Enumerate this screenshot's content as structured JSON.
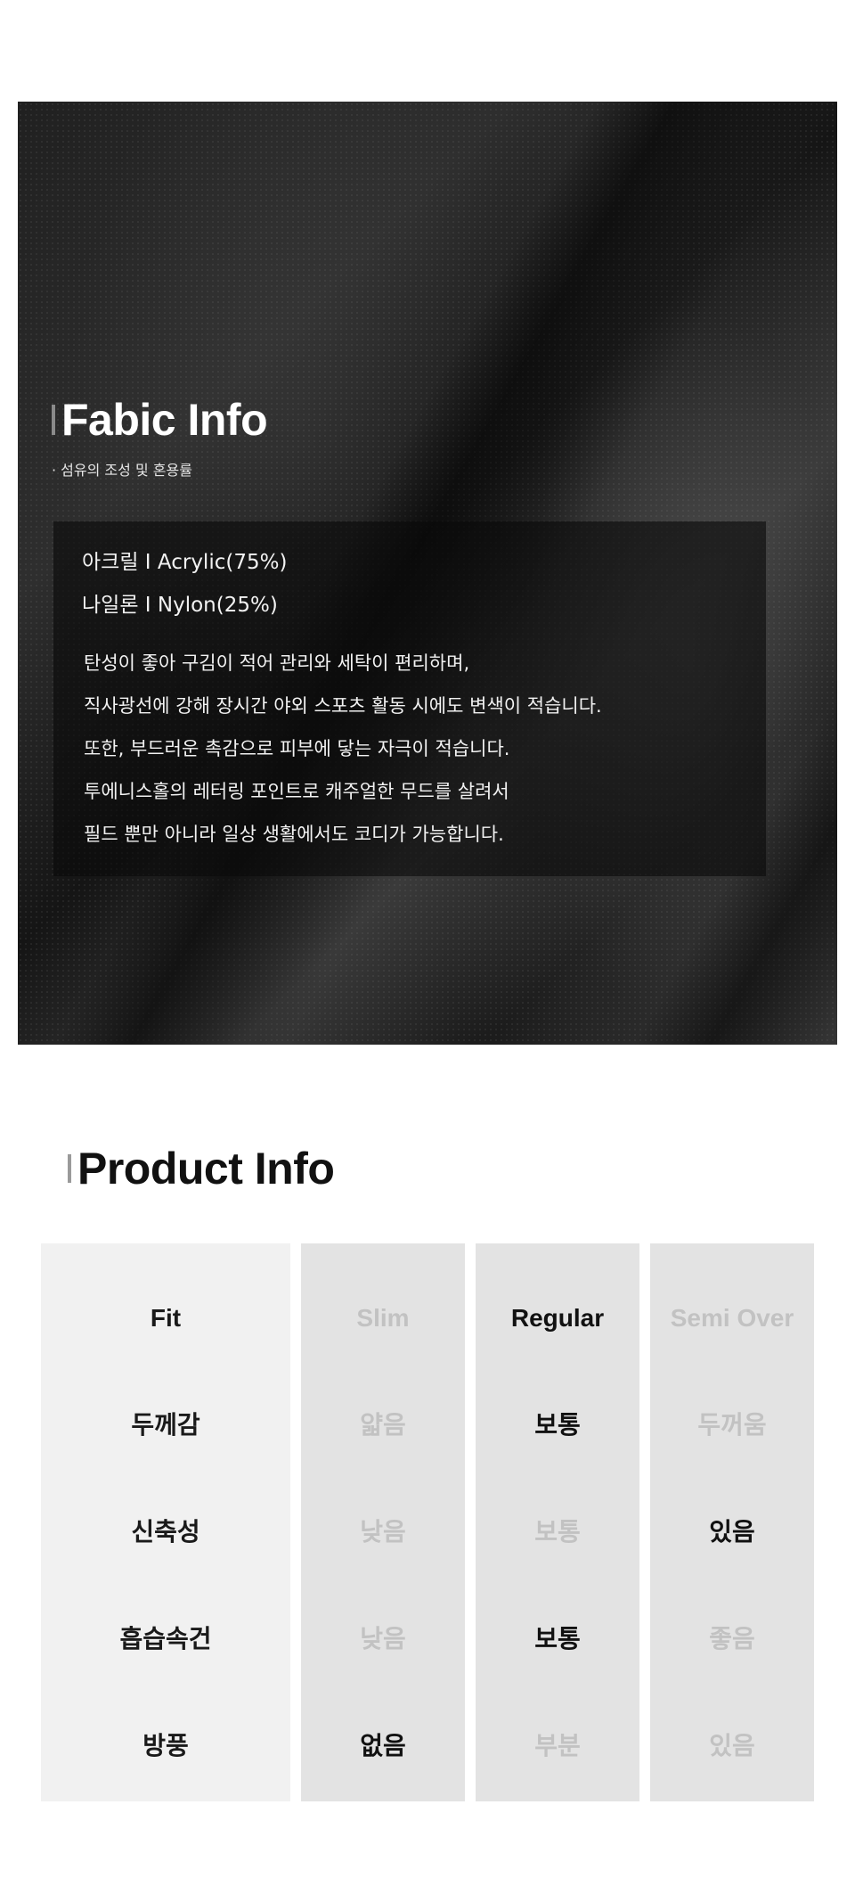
{
  "fabric_info": {
    "title": "Fabic Info",
    "subtitle": "· 섬유의 조성 및 혼용률",
    "composition": [
      "아크릴 I Acrylic(75%)",
      "나일론 I Nylon(25%)"
    ],
    "description": [
      "탄성이 좋아 구김이 적어 관리와 세탁이 편리하며,",
      "직사광선에 강해 장시간 야외 스포츠 활동 시에도 변색이 적습니다.",
      "또한, 부드러운 촉감으로 피부에 닿는 자극이 적습니다.",
      "투에니스홀의 레터링 포인트로 캐주얼한 무드를 살려서",
      "필드 뿐만 아니라 일상 생활에서도 코디가 가능합니다."
    ]
  },
  "product_info": {
    "title": "Product Info",
    "rows": [
      {
        "label": "Fit",
        "options": [
          "Slim",
          "Regular",
          "Semi Over"
        ],
        "selected": [
          "Regular"
        ]
      },
      {
        "label": "두께감",
        "options": [
          "얇음",
          "보통",
          "두꺼움"
        ],
        "selected": [
          "보통"
        ]
      },
      {
        "label": "신축성",
        "options": [
          "낮음",
          "보통",
          "있음"
        ],
        "selected": [
          "있음"
        ]
      },
      {
        "label": "흡습속건",
        "options": [
          "낮음",
          "보통",
          "좋음"
        ],
        "selected": [
          "보통"
        ]
      },
      {
        "label": "방풍",
        "options": [
          "없음",
          "부분",
          "있음"
        ],
        "selected": [
          "없음"
        ]
      }
    ]
  },
  "colors": {
    "active_text": "#111111",
    "inactive_text": "#c2c2c2",
    "label_column_bg": "#f1f1f1",
    "option_column_bg": "#e3e3e3"
  }
}
